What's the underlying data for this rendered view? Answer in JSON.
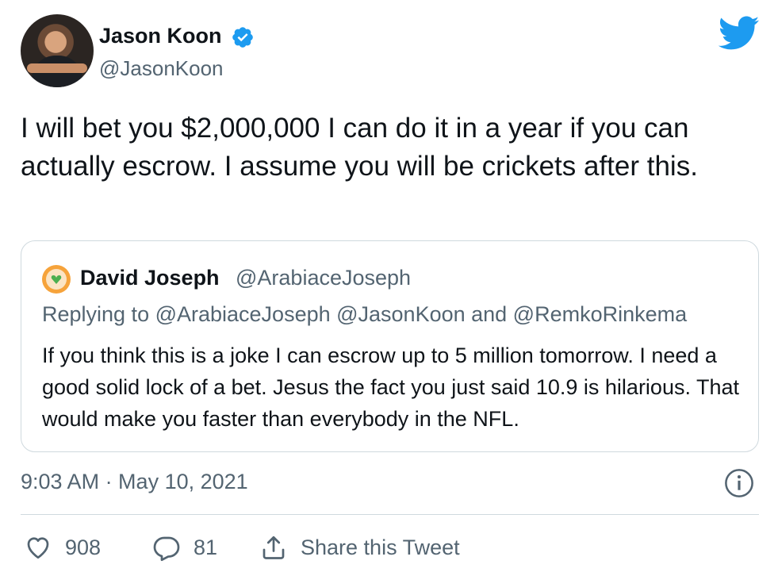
{
  "author": {
    "display_name": "Jason Koon",
    "handle": "@JasonKoon",
    "verified": true
  },
  "tweet": {
    "text": "I will bet you $2,000,000 I can do it in a year if you can actually escrow. I assume you will be crickets after this."
  },
  "quoted_tweet": {
    "display_name": "David Joseph",
    "handle": "@ArabiaceJoseph",
    "replying_to": "Replying to @ArabiaceJoseph @JasonKoon and @RemkoRinkema",
    "text": "If you think this is a joke I can escrow up to 5 million tomorrow. I need a good solid lock of a bet. Jesus the fact you just said 10.9 is hilarious. That would make you faster than everybody in the NFL."
  },
  "timestamp": "9:03 AM · May 10, 2021",
  "actions": {
    "likes": "908",
    "replies": "81",
    "share_label": "Share this Tweet"
  },
  "colors": {
    "twitter_blue": "#1d9bf0",
    "text_primary": "#0f1419",
    "text_secondary": "#536471",
    "border": "#cfd9de"
  },
  "icons": [
    "verified-badge-icon",
    "twitter-bird-icon",
    "info-icon",
    "heart-icon",
    "reply-bubble-icon",
    "share-icon"
  ]
}
